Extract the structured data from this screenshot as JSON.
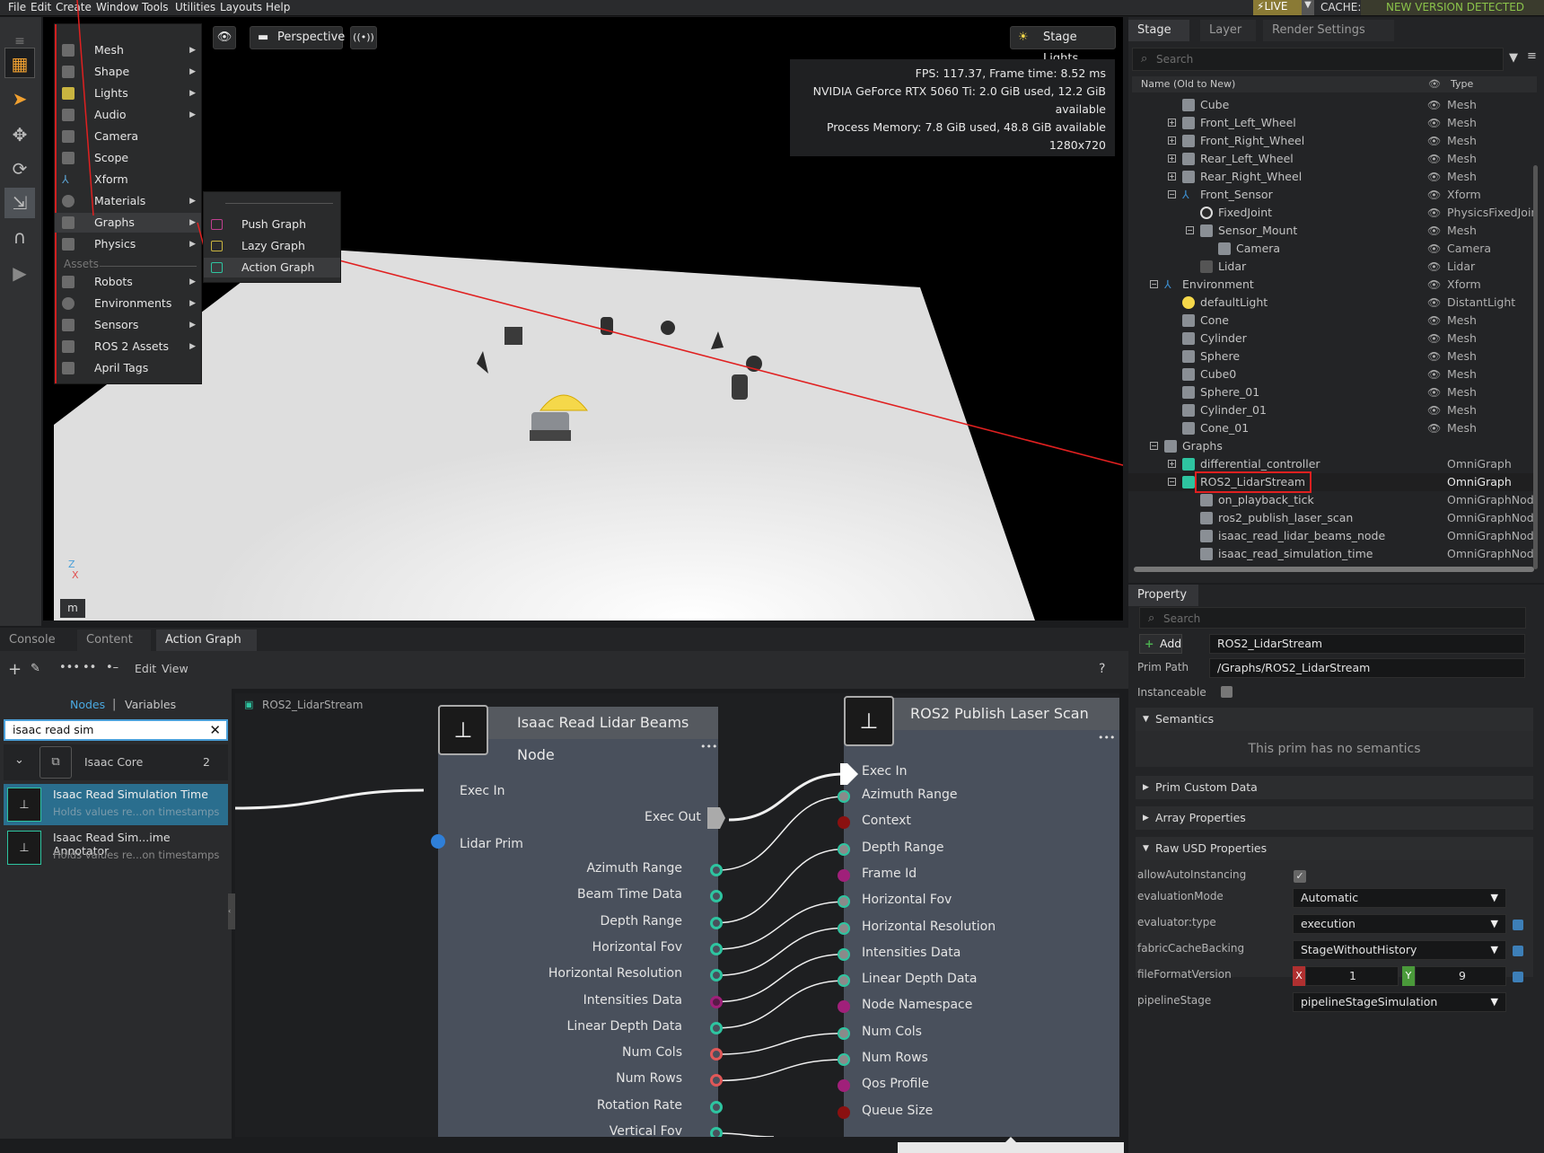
{
  "menubar": {
    "items": [
      "File",
      "Edit",
      "Create",
      "Window",
      "Tools",
      "Utilities",
      "Layouts",
      "Help"
    ],
    "live": "LIVE",
    "cache": "CACHE:",
    "new_version": "NEW VERSION DETECTED"
  },
  "viewport": {
    "camera": "Perspective",
    "lights": "Stage Lights",
    "stats": [
      "FPS: 117.37, Frame time: 8.52 ms",
      "NVIDIA GeForce RTX 5060 Ti: 2.0 GiB used, 12.2 GiB available",
      "Process Memory: 7.8 GiB used, 48.8 GiB available",
      "1280x720"
    ],
    "axis_z": "Z",
    "axis_x": "X",
    "units": "m"
  },
  "create_menu": {
    "items": [
      "Mesh",
      "Shape",
      "Lights",
      "Audio",
      "Camera",
      "Scope",
      "Xform",
      "Materials",
      "Graphs",
      "Physics"
    ],
    "assets_header": "Assets",
    "asset_items": [
      "Robots",
      "Environments",
      "Sensors",
      "ROS 2 Assets",
      "April Tags"
    ],
    "graph_submenu": [
      "Push Graph",
      "Lazy Graph",
      "Action Graph"
    ]
  },
  "stage": {
    "tabs": [
      "Stage",
      "Layer",
      "Render Settings"
    ],
    "search_placeholder": "Search",
    "col_name": "Name (Old to New)",
    "col_type": "Type",
    "rows": [
      {
        "name": "Cube",
        "type": "Mesh"
      },
      {
        "name": "Front_Left_Wheel",
        "type": "Mesh"
      },
      {
        "name": "Front_Right_Wheel",
        "type": "Mesh"
      },
      {
        "name": "Rear_Left_Wheel",
        "type": "Mesh"
      },
      {
        "name": "Rear_Right_Wheel",
        "type": "Mesh"
      },
      {
        "name": "Front_Sensor",
        "type": "Xform"
      },
      {
        "name": "FixedJoint",
        "type": "PhysicsFixedJoint"
      },
      {
        "name": "Sensor_Mount",
        "type": "Mesh"
      },
      {
        "name": "Camera",
        "type": "Camera"
      },
      {
        "name": "Lidar",
        "type": "Lidar"
      },
      {
        "name": "Environment",
        "type": "Xform"
      },
      {
        "name": "defaultLight",
        "type": "DistantLight"
      },
      {
        "name": "Cone",
        "type": "Mesh"
      },
      {
        "name": "Cylinder",
        "type": "Mesh"
      },
      {
        "name": "Sphere",
        "type": "Mesh"
      },
      {
        "name": "Cube0",
        "type": "Mesh"
      },
      {
        "name": "Sphere_01",
        "type": "Mesh"
      },
      {
        "name": "Cylinder_01",
        "type": "Mesh"
      },
      {
        "name": "Cone_01",
        "type": "Mesh"
      },
      {
        "name": "Graphs",
        "type": ""
      },
      {
        "name": "differential_controller",
        "type": "OmniGraph"
      },
      {
        "name": "ROS2_LidarStream",
        "type": "OmniGraph"
      },
      {
        "name": "on_playback_tick",
        "type": "OmniGraphNode"
      },
      {
        "name": "ros2_publish_laser_scan",
        "type": "OmniGraphNode"
      },
      {
        "name": "isaac_read_lidar_beams_node",
        "type": "OmniGraphNode"
      },
      {
        "name": "isaac_read_simulation_time",
        "type": "OmniGraphNode"
      }
    ]
  },
  "property": {
    "tab": "Property",
    "search_placeholder": "Search",
    "add_label": "Add",
    "prim_name": "ROS2_LidarStream",
    "prim_path_label": "Prim Path",
    "prim_path": "/Graphs/ROS2_LidarStream",
    "instanceable_label": "Instanceable",
    "sections": {
      "semantics": "Semantics",
      "no_semantics": "This prim has no semantics",
      "custom": "Prim Custom Data",
      "array": "Array Properties",
      "raw": "Raw USD Properties"
    },
    "raw": [
      {
        "label": "allowAutoInstancing",
        "value": ""
      },
      {
        "label": "evaluationMode",
        "value": "Automatic"
      },
      {
        "label": "evaluator:type",
        "value": "execution"
      },
      {
        "label": "fabricCacheBacking",
        "value": "StageWithoutHistory"
      },
      {
        "label": "fileFormatVersion",
        "value": ""
      },
      {
        "label": "pipelineStage",
        "value": "pipelineStageSimulation"
      }
    ],
    "ffv_x_label": "X",
    "ffv_x": "1",
    "ffv_y_label": "Y",
    "ffv_y": "9"
  },
  "bottom": {
    "tabs": [
      "Console",
      "Content",
      "Action Graph"
    ],
    "edit": "Edit",
    "view": "View",
    "help": "?",
    "nodes_tab": "Nodes",
    "variables_tab": "Variables",
    "search_value": "isaac read sim",
    "category": "Isaac Core",
    "category_count": "2",
    "results": [
      {
        "title": "Isaac Read Simulation Time",
        "desc": "Holds values re...on timestamps"
      },
      {
        "title": "Isaac Read Sim...ime Annotator",
        "desc": "Holds values re...on timestamps"
      }
    ],
    "graph_name": "ROS2_LidarStream"
  },
  "node_lidar": {
    "title": "Isaac Read Lidar Beams Node",
    "exec_in": "Exec In",
    "exec_out": "Exec Out",
    "lidar_prim": "Lidar Prim",
    "outputs": [
      "Azimuth Range",
      "Beam Time Data",
      "Depth Range",
      "Horizontal Fov",
      "Horizontal Resolution",
      "Intensities Data",
      "Linear Depth Data",
      "Num Cols",
      "Num Rows",
      "Rotation Rate",
      "Vertical Fov"
    ]
  },
  "node_ros": {
    "title": "ROS2 Publish Laser Scan",
    "inputs": [
      "Exec In",
      "Azimuth Range",
      "Context",
      "Depth Range",
      "Frame Id",
      "Horizontal Fov",
      "Horizontal Resolution",
      "Intensities Data",
      "Linear Depth Data",
      "Node Namespace",
      "Num Cols",
      "Num Rows",
      "Qos Profile",
      "Queue Size"
    ]
  },
  "colors": {
    "accent_red": "#e02020",
    "port_green": "#2ec4a0",
    "port_red": "#e05858",
    "port_magenta": "#a0207a",
    "port_darkred": "#8a1010",
    "node_body": "#49505c"
  }
}
